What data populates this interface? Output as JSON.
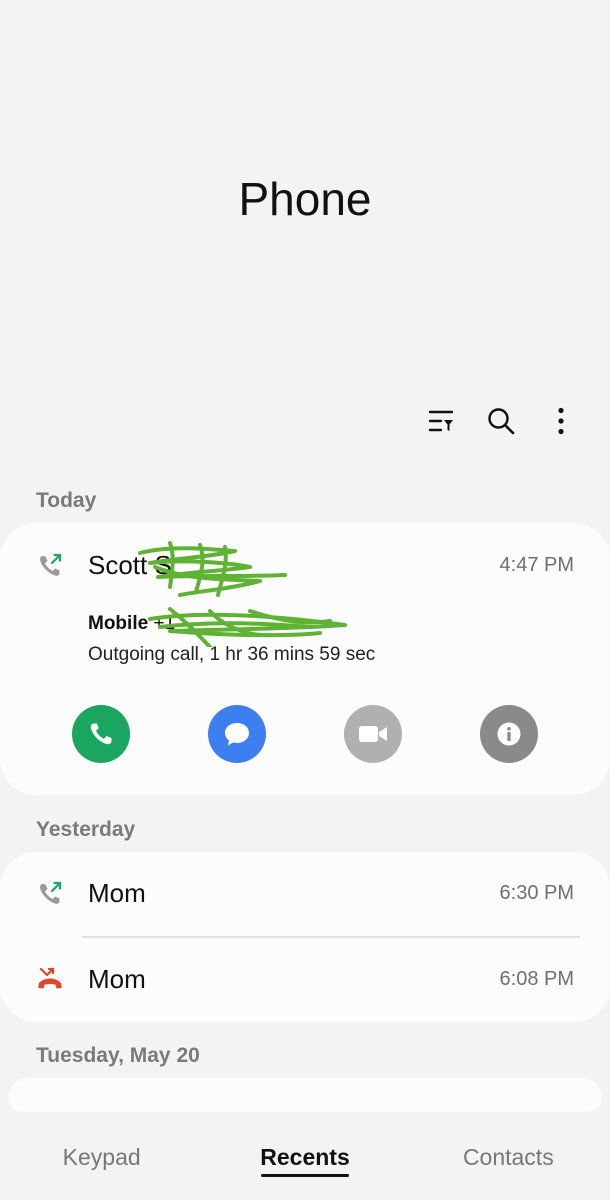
{
  "app": {
    "title": "Phone"
  },
  "toolbar": {
    "filter_icon": "filter-icon",
    "search_icon": "search-icon",
    "more_icon": "more-vertical-icon"
  },
  "sections": {
    "today": {
      "label": "Today",
      "entries": [
        {
          "name": "Scott S",
          "time": "4:47 PM",
          "type": "outgoing",
          "number_label": "Mobile",
          "number": "+1",
          "call_info": "Outgoing call, 1 hr 36 mins 59 sec"
        }
      ]
    },
    "yesterday": {
      "label": "Yesterday",
      "entries": [
        {
          "name": "Mom",
          "time": "6:30 PM",
          "type": "outgoing"
        },
        {
          "name": "Mom",
          "time": "6:08 PM",
          "type": "missed"
        }
      ]
    },
    "tuesday": {
      "label": "Tuesday, May 20"
    }
  },
  "actions": {
    "call": "phone-icon",
    "message": "message-icon",
    "video": "video-icon",
    "info": "info-icon"
  },
  "colors": {
    "call": "#1aa561",
    "message": "#3d7ef0",
    "video": "#b0b0b0",
    "info": "#8a8a8a",
    "outgoing_arrow": "#1aa561",
    "missed": "#e0442f"
  },
  "bottom_nav": {
    "tabs": [
      "Keypad",
      "Recents",
      "Contacts"
    ],
    "active": "Recents"
  }
}
